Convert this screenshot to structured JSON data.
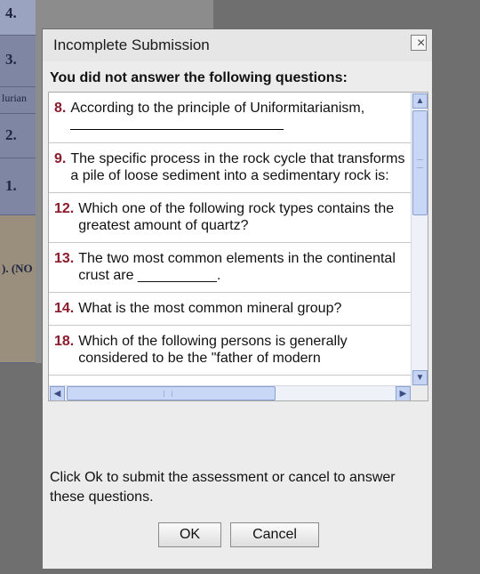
{
  "background": {
    "cells": [
      "4.",
      "3.",
      "lurian",
      "2.",
      "1.",
      "). (NO"
    ]
  },
  "dialog": {
    "title": "Incomplete Submission",
    "close_label": "×",
    "heading": "You did not answer the following questions:",
    "questions": [
      {
        "number": "8.",
        "text": "According to the principle of Uniformitarianism,"
      },
      {
        "number": "9.",
        "text": "The specific process in the rock cycle that transforms a pile of loose sediment into a sedimentary rock is:"
      },
      {
        "number": "12.",
        "text": "Which one of the following rock types contains the greatest amount of quartz?"
      },
      {
        "number": "13.",
        "text": "The two most common elements in the continental crust are __________."
      },
      {
        "number": "14.",
        "text": "What is the most common mineral group?"
      },
      {
        "number": "18.",
        "text": "Which of the following persons is generally considered to be the \"father of modern"
      }
    ],
    "instruction": "Click Ok to submit the assessment or cancel to answer these questions.",
    "ok_label": "OK",
    "cancel_label": "Cancel",
    "scroll_icons": {
      "up": "▲",
      "down": "▼",
      "left": "◀",
      "right": "▶"
    }
  }
}
